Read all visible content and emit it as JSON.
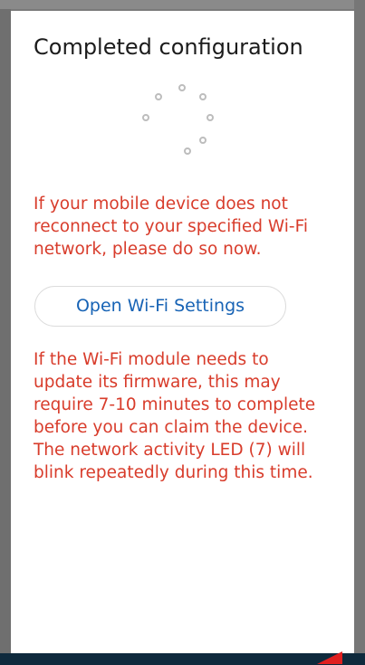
{
  "dialog": {
    "title": "Completed configuration",
    "reconnect_message": "If your mobile device does not reconnect to your specified Wi-Fi network, please do so now.",
    "open_wifi_button_label": "Open Wi-Fi Settings",
    "firmware_message": "If the Wi-Fi module needs to update its firmware, this may require 7-10 minutes to complete before you can claim the device. The network activity LED (7) will blink repeatedly during this time."
  },
  "colors": {
    "message_text": "#d83c2b",
    "button_text": "#1763b5",
    "title_text": "#1c1c1c",
    "spinner_dot": "#bdbdbd",
    "annotation_arrow": "#e02020"
  },
  "icons": {
    "spinner": "loading-spinner-icon",
    "annotation": "red-arrow-icon"
  }
}
